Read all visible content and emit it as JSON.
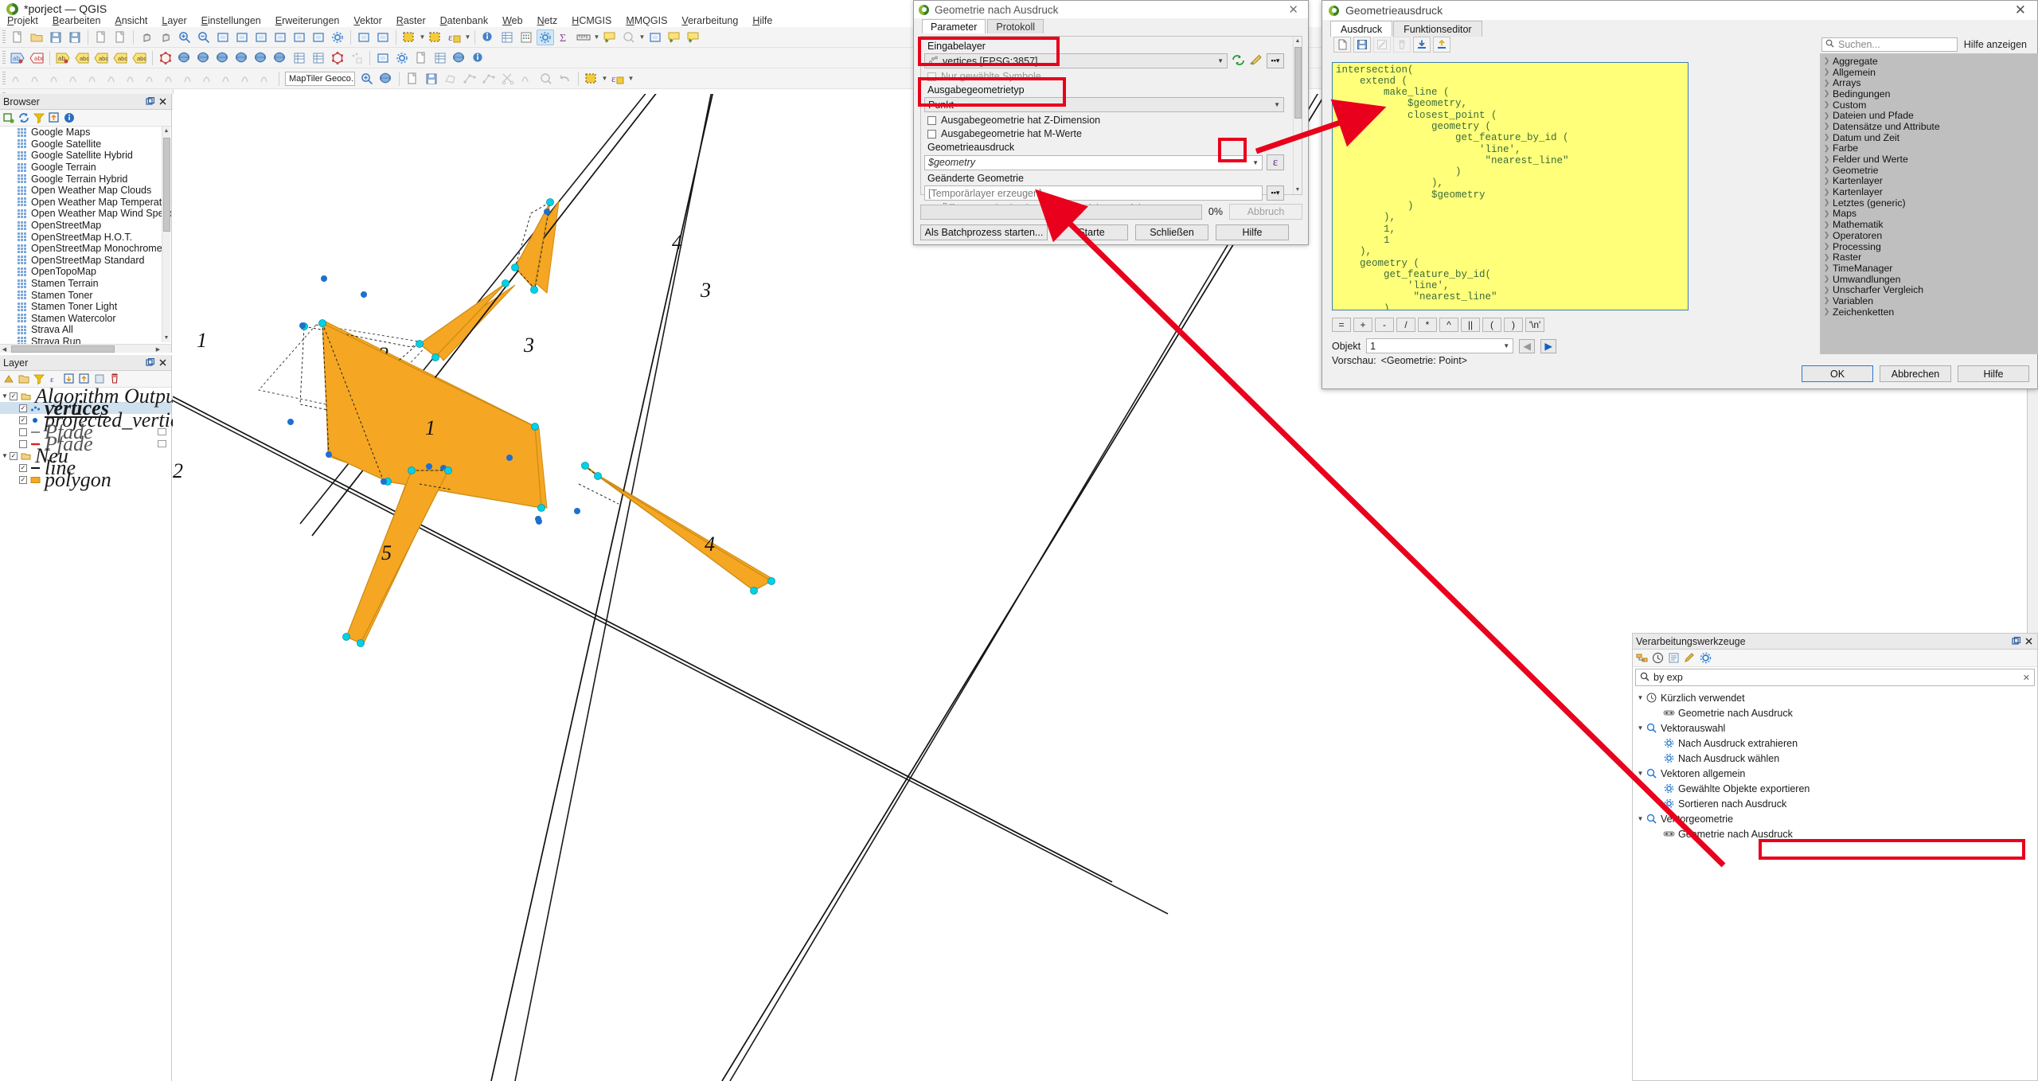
{
  "window": {
    "title": "*porject — QGIS",
    "logo_icon": "qgis-logo"
  },
  "menubar": {
    "items": [
      "Projekt",
      "Bearbeiten",
      "Ansicht",
      "Layer",
      "Einstellungen",
      "Erweiterungen",
      "Vektor",
      "Raster",
      "Datenbank",
      "Web",
      "Netz",
      "HCMGIS",
      "MMQGIS",
      "Verarbeitung",
      "Hilfe"
    ]
  },
  "toolbars": {
    "geocoder_value": "MapTiler Geoco..."
  },
  "browser": {
    "title": "Browser",
    "tools": [
      "add-layer-icon",
      "refresh-icon",
      "filter-icon",
      "collapse-all-icon",
      "properties-icon"
    ],
    "items": [
      "Google Maps",
      "Google Satellite",
      "Google Satellite Hybrid",
      "Google Terrain",
      "Google Terrain Hybrid",
      "Open Weather Map Clouds",
      "Open Weather Map Temperature",
      "Open Weather Map Wind Speed",
      "OpenStreetMap",
      "OpenStreetMap H.O.T.",
      "OpenStreetMap Monochrome",
      "OpenStreetMap Standard",
      "OpenTopoMap",
      "Stamen Terrain",
      "Stamen Toner",
      "Stamen Toner Light",
      "Stamen Watercolor",
      "Strava All",
      "Strava Run"
    ]
  },
  "layers": {
    "title": "Layer",
    "groups": [
      {
        "name": "Algorithm Output",
        "checked": true,
        "expanded": true,
        "children": [
          {
            "name": "vertices",
            "checked": true,
            "symbol": "points",
            "selected": true
          },
          {
            "name": "projected_vertices",
            "checked": true,
            "symbol": "point-blue"
          },
          {
            "name": "Pfade",
            "checked": false,
            "symbol": "line-grey",
            "italic": true
          },
          {
            "name": "Pfade",
            "checked": false,
            "symbol": "line-red",
            "italic": true
          }
        ]
      },
      {
        "name": "Neu",
        "checked": true,
        "expanded": true,
        "children": [
          {
            "name": "line",
            "checked": true,
            "symbol": "line-black"
          },
          {
            "name": "polygon",
            "checked": true,
            "symbol": "fill-orange"
          }
        ]
      }
    ]
  },
  "algorithm_dialog": {
    "title": "Geometrie nach Ausdruck",
    "close_label": "✕",
    "tabs": [
      {
        "label": "Parameter",
        "active": true
      },
      {
        "label": "Protokoll",
        "active": false
      }
    ],
    "input_layer_label": "Eingabelayer",
    "input_layer_value": "vertices [EPSG:3857]",
    "selected_only_label": "Nur gewählte Symbole",
    "selected_only_checked": false,
    "output_geom_label": "Ausgabegeometrietyp",
    "output_geom_value": "Punkt",
    "has_z_label": "Ausgabegeometrie hat Z-Dimension",
    "has_z_checked": false,
    "has_m_label": "Ausgabegeometrie hat M-Werte",
    "has_m_checked": false,
    "geometry_expression_label": "Geometrieausdruck",
    "geometry_expression_value": "$geometry",
    "expression_button_label": "ε",
    "changed_geometry_label": "Geänderte Geometrie",
    "changed_geometry_placeholder": "[Temporärlayer erzeugen]",
    "open_output_label": "Öffne Ausgabedatei nach erfolgreicher Ausführung",
    "open_output_checked": true,
    "progress_text": "0%",
    "cancel_label": "Abbruch",
    "batch_label": "Als Batchprozess starten...",
    "run_label": "Starte",
    "close_btn_label": "Schließen",
    "help_label": "Hilfe"
  },
  "expression_dialog": {
    "title": "Geometrieausdruck",
    "close_label": "✕",
    "tabs": [
      {
        "label": "Ausdruck",
        "active": true
      },
      {
        "label": "Funktionseditor",
        "active": false
      }
    ],
    "toolbar_icons": [
      "new-file-icon",
      "save-icon",
      "edit-icon",
      "delete-icon",
      "import-icon",
      "export-icon"
    ],
    "search_placeholder": "Suchen...",
    "help_link": "Hilfe anzeigen",
    "code": "intersection(\n    extend (\n        make_line (\n            $geometry,\n            closest_point (\n                geometry (\n                    get_feature_by_id (\n                        'line',\n                         \"nearest_line\"\n                    )\n                ),\n                $geometry\n            )\n        ),\n        1,\n        1\n    ),\n    geometry (\n        get_feature_by_id(\n            'line',\n             \"nearest_line\"\n        )\n    )\n)",
    "operator_buttons": [
      "=",
      "+",
      "-",
      "/",
      "*",
      "^",
      "||",
      "(",
      ")",
      "'\\n'"
    ],
    "object_label": "Objekt",
    "object_value": "1",
    "preview_label": "Vorschau:",
    "preview_value": "<Geometrie: Point>",
    "function_groups": [
      "Aggregate",
      "Allgemein",
      "Arrays",
      "Bedingungen",
      "Custom",
      "Dateien und Pfade",
      "Datensätze und Attribute",
      "Datum und Zeit",
      "Farbe",
      "Felder und Werte",
      "Geometrie",
      "Kartenlayer",
      "Kartenlayer",
      "Letztes (generic)",
      "Maps",
      "Mathematik",
      "Operatoren",
      "Processing",
      "Raster",
      "TimeManager",
      "Umwandlungen",
      "Unscharfer Vergleich",
      "Variablen",
      "Zeichenketten"
    ],
    "ok_label": "OK",
    "cancel_label": "Abbrechen",
    "help_label": "Hilfe"
  },
  "processing_toolbox": {
    "title": "Verarbeitungswerkzeuge",
    "search_value": "by exp",
    "tree": [
      {
        "label": "Kürzlich verwendet",
        "level": 0,
        "icon": "clock-icon",
        "expanded": true
      },
      {
        "label": "Geometrie nach Ausdruck",
        "level": 1,
        "icon": "alg-icon"
      },
      {
        "label": "Vektorauswahl",
        "level": 0,
        "icon": "search-q-icon",
        "expanded": true
      },
      {
        "label": "Nach Ausdruck extrahieren",
        "level": 1,
        "icon": "gear-icon"
      },
      {
        "label": "Nach Ausdruck wählen",
        "level": 1,
        "icon": "gear-icon"
      },
      {
        "label": "Vektoren allgemein",
        "level": 0,
        "icon": "search-q-icon",
        "expanded": true
      },
      {
        "label": "Gewählte Objekte exportieren",
        "level": 1,
        "icon": "gear-icon"
      },
      {
        "label": "Sortieren nach Ausdruck",
        "level": 1,
        "icon": "gear-icon"
      },
      {
        "label": "Vektorgeometrie",
        "level": 0,
        "icon": "search-q-icon",
        "expanded": true
      },
      {
        "label": "Geometrie nach Ausdruck",
        "level": 1,
        "icon": "alg-icon",
        "highlighted": true
      }
    ]
  },
  "canvas": {
    "feature_labels": [
      "1",
      "2",
      "3",
      "4",
      "5",
      "1",
      "2",
      "3",
      "4"
    ],
    "polygon_fill": "#F5A623",
    "vertex_color": "#00d0e0",
    "node_color": "#1f6fd0"
  },
  "colors": {
    "highlight_red": "#e8001c",
    "code_bg": "#ffff7a",
    "accent_blue": "#3f7fa8"
  }
}
